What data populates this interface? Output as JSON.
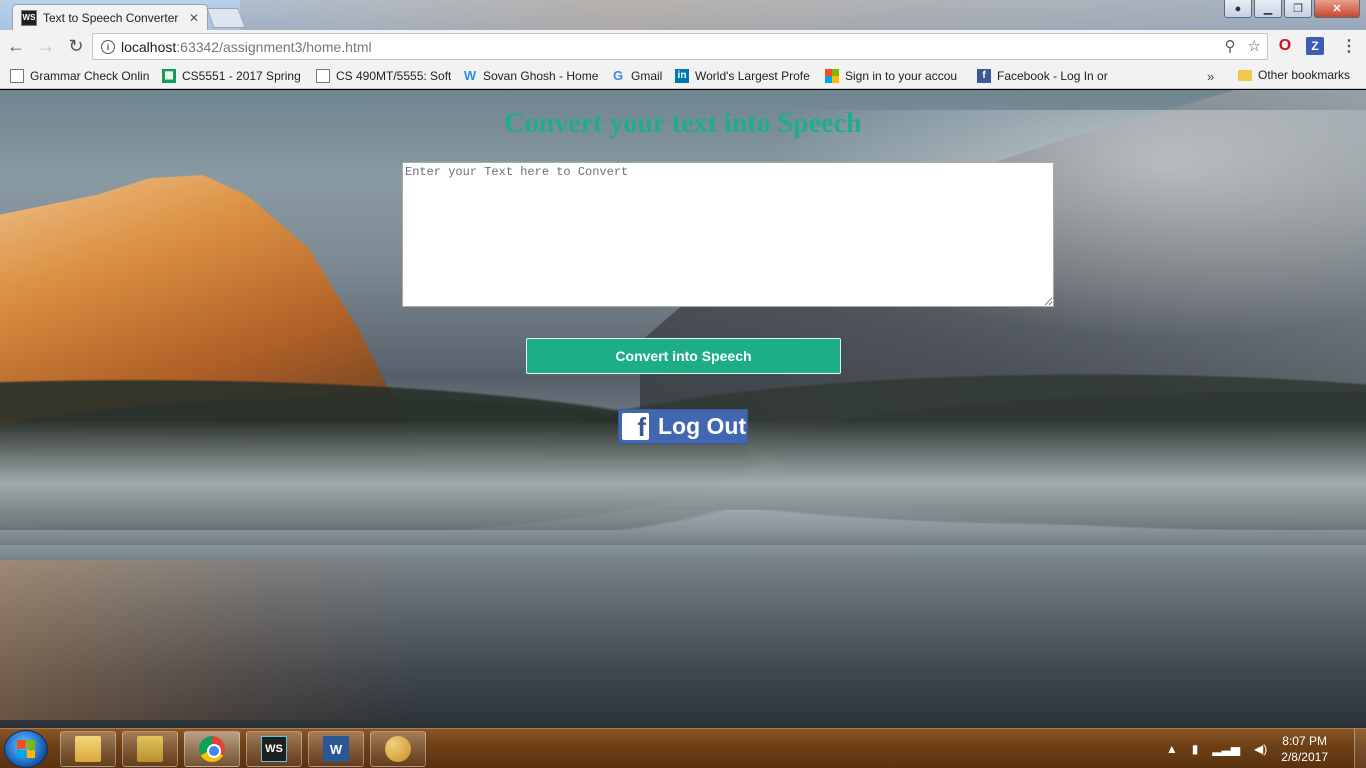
{
  "browser": {
    "tab_title": "Text to Speech Converter",
    "tab_favicon_text": "WS",
    "address_host": "localhost",
    "address_path": ":63342/assignment3/home.html",
    "bookmarks": [
      {
        "label": "Grammar Check Onlin",
        "icon": "document-icon",
        "icon_color": "#555555"
      },
      {
        "label": "CS5551 - 2017 Spring",
        "icon": "sheets-icon",
        "icon_color": "#0f9d58"
      },
      {
        "label": "CS 490MT/5555: Softw",
        "icon": "document-icon",
        "icon_color": "#555555"
      },
      {
        "label": "Sovan Ghosh - Home",
        "icon": "weebly-icon",
        "icon_color": "#2990ea"
      },
      {
        "label": "Gmail",
        "icon": "google-icon",
        "icon_color": "#4285f4"
      },
      {
        "label": "World's Largest Profe",
        "icon": "linkedin-icon",
        "icon_color": "#0077b5"
      },
      {
        "label": "Sign in to your accou",
        "icon": "microsoft-icon",
        "icon_color": "#f25022"
      },
      {
        "label": "Facebook - Log In or",
        "icon": "facebook-icon",
        "icon_color": "#3b5998"
      }
    ],
    "bookmarks_overflow": "»",
    "other_bookmarks": "Other bookmarks"
  },
  "page": {
    "heading": "Convert your text into Speech",
    "textarea_placeholder": "Enter your Text here to Convert",
    "textarea_value": "",
    "convert_button": "Convert into Speech",
    "logout_button": "Log Out",
    "accent_color": "#1eae87",
    "facebook_color": "#4366b0"
  },
  "taskbar": {
    "apps": [
      "windows-explorer",
      "file-explorer",
      "google-chrome",
      "webstorm",
      "microsoft-word",
      "paint"
    ],
    "active_app": "google-chrome",
    "ws_label": "WS",
    "word_label": "W",
    "clock_time": "8:07 PM",
    "clock_date": "2/8/2017"
  }
}
